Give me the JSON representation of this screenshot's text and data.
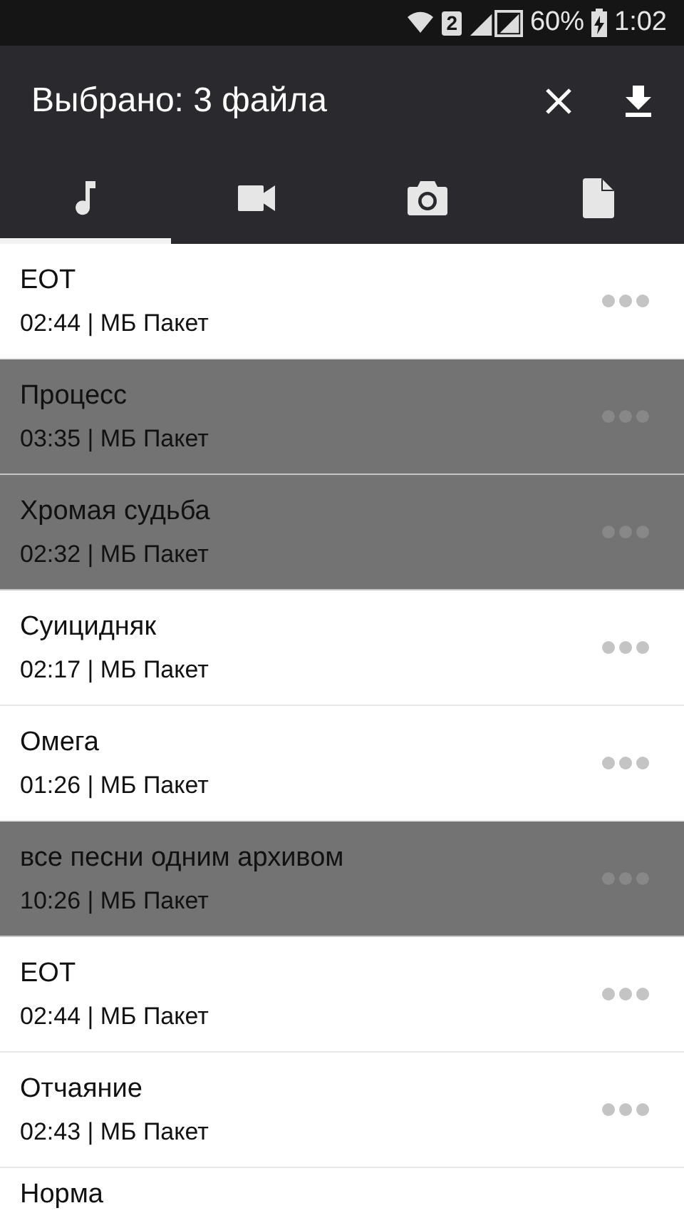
{
  "status_bar": {
    "sim": "2",
    "battery": "60%",
    "time": "1:02"
  },
  "app_bar": {
    "title": "Выбрано: 3 файла"
  },
  "tabs": [
    {
      "kind": "music",
      "selected": true
    },
    {
      "kind": "video",
      "selected": false
    },
    {
      "kind": "photo",
      "selected": false
    },
    {
      "kind": "document",
      "selected": false
    }
  ],
  "tracks": [
    {
      "title": "ЕОТ",
      "subtitle": "02:44 | МБ Пакет",
      "selected": false
    },
    {
      "title": "Процесс",
      "subtitle": "03:35 | МБ Пакет",
      "selected": true
    },
    {
      "title": "Хромая судьба",
      "subtitle": "02:32 | МБ Пакет",
      "selected": true
    },
    {
      "title": "Суицидняк",
      "subtitle": "02:17 | МБ Пакет",
      "selected": false
    },
    {
      "title": "Омега",
      "subtitle": "01:26 | МБ Пакет",
      "selected": false
    },
    {
      "title": "все песни одним архивом",
      "subtitle": "10:26 | МБ Пакет",
      "selected": true
    },
    {
      "title": "ЕОТ",
      "subtitle": "02:44 | МБ Пакет",
      "selected": false
    },
    {
      "title": "Отчаяние",
      "subtitle": "02:43 | МБ Пакет",
      "selected": false
    },
    {
      "title": "Норма",
      "selected": false
    }
  ]
}
